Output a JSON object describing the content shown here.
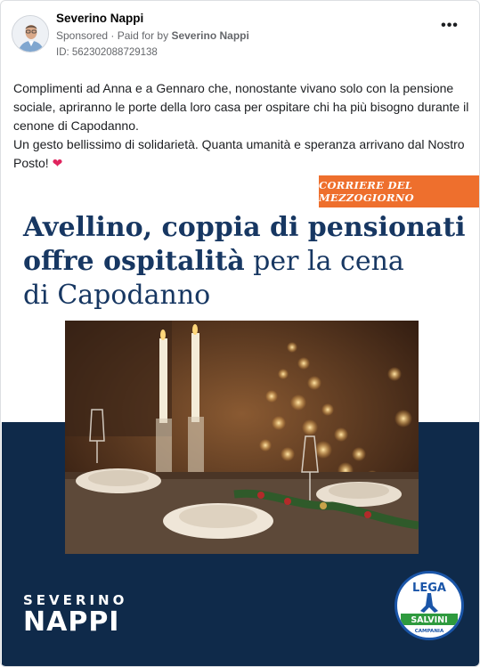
{
  "post": {
    "author": "Severino Nappi",
    "sponsored_label": "Sponsored",
    "separator": "·",
    "paid_for_prefix": "Paid for by",
    "paid_for_name": "Severino Nappi",
    "ad_id": "ID: 562302088729138",
    "more_icon": "•••",
    "body_line1": "Complimenti ad Anna e a Gennaro che, nonostante vivano solo con la pensione sociale, apriranno le porte della loro casa per ospitare chi ha più bisogno durante il cenone di Capodanno.",
    "body_line2": "Un gesto bellissimo di solidarietà. Quanta umanità e speranza arrivano dal Nostro Posto!",
    "heart_icon": "❤"
  },
  "creative": {
    "newspaper": "CORRIERE DEL MEZZOGIORNO",
    "headline_bold_1": "Avellino, coppia di pensionati",
    "headline_bold_2": "offre ospitalità",
    "headline_regular_2": " per la cena",
    "headline_regular_3": "di Capodanno",
    "brand_first": "SEVERINO",
    "brand_last": "NAPPI",
    "logo_top": "LEGA",
    "logo_band": "SALVINI",
    "logo_bottom": "CAMPANIA",
    "colors": {
      "navy": "#0f2a4a",
      "headline": "#173762",
      "badge": "#ee6f2d",
      "lega_blue": "#1a55a8",
      "lega_green": "#2e9a3e"
    }
  }
}
